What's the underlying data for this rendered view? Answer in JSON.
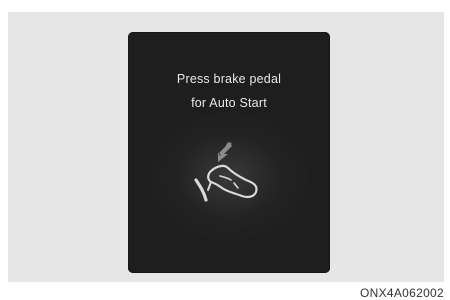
{
  "display": {
    "line1": "Press brake pedal",
    "line2": "for Auto Start",
    "icon": "foot-on-brake-pedal-icon"
  },
  "figure_code": "ONX4A062002",
  "colors": {
    "display_background": "#1e1e1e",
    "text": "#e8e8e8",
    "icon": "#d9d9d9",
    "arrow": "#8c8c8c"
  }
}
